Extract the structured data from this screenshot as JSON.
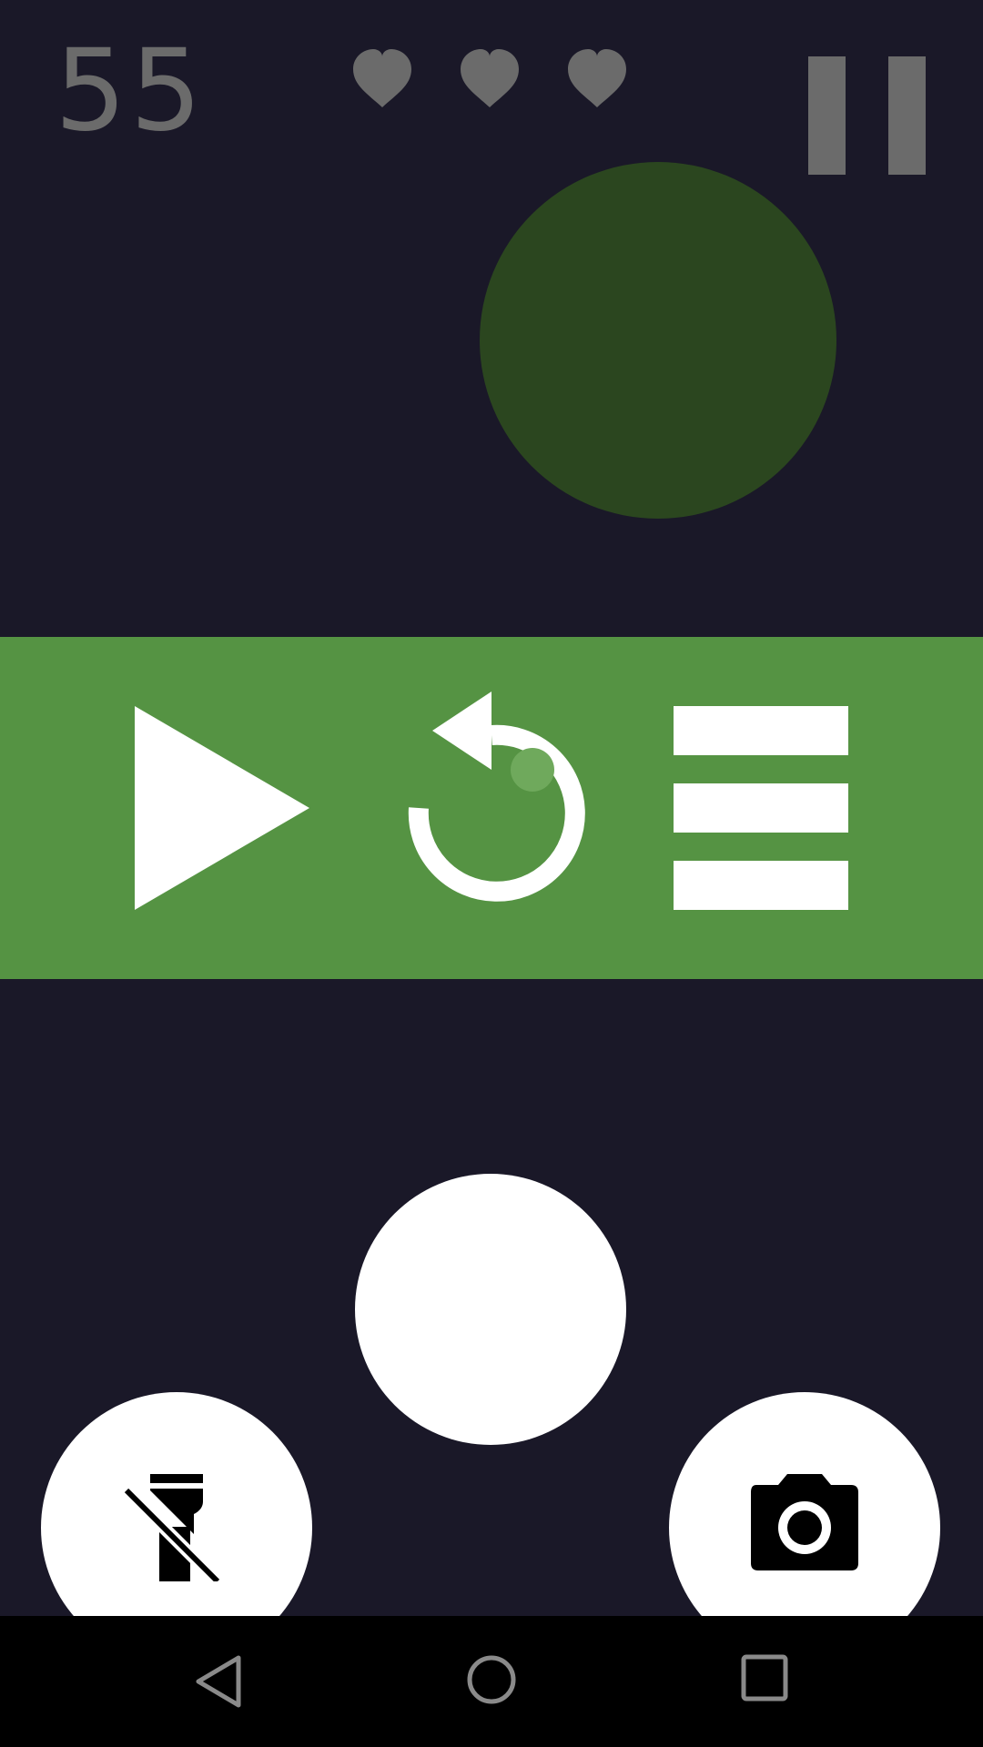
{
  "hud": {
    "score": "55",
    "lives": 3,
    "pause_icon": "pause-icon",
    "text_color": "#6b6b6b"
  },
  "target_color": "#2b461f",
  "menu": {
    "background": "#559343",
    "items": [
      {
        "name": "play",
        "icon": "play-icon"
      },
      {
        "name": "restart",
        "icon": "restart-icon"
      },
      {
        "name": "menu",
        "icon": "menu-icon"
      }
    ]
  },
  "controls": {
    "center_button": "shutter-button",
    "left_button_icon": "flashlight-off-icon",
    "right_button_icon": "camera-icon"
  },
  "navbar": {
    "items": [
      "back-icon",
      "home-icon",
      "recents-icon"
    ]
  },
  "colors": {
    "background": "#1a1828",
    "navbar": "#000000",
    "white": "#ffffff"
  }
}
